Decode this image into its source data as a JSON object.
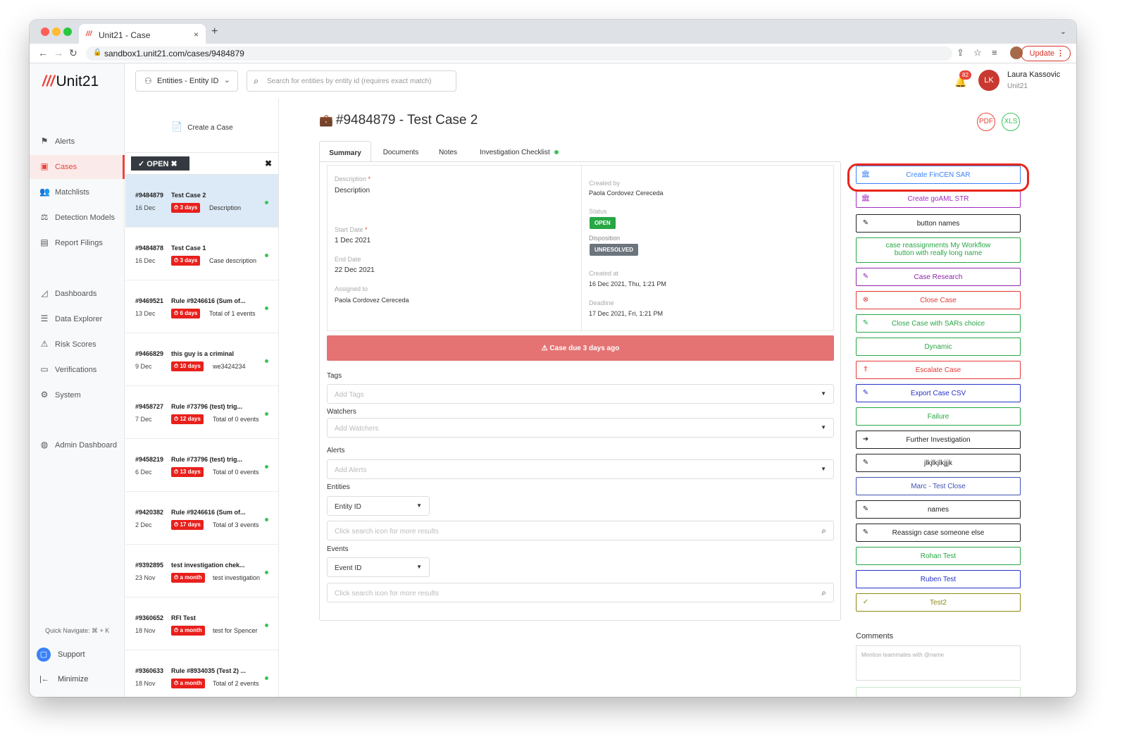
{
  "browser": {
    "tab_title": "Unit21 - Case",
    "tab_favicon": "///",
    "tab_close": "×",
    "new_tab": "+",
    "url": "sandbox1.unit21.com/cases/9484879",
    "update_label": "Update"
  },
  "sidebar": {
    "logo_slash": "///",
    "logo_text": "Unit21",
    "items": [
      {
        "label": "Alerts",
        "icon": "flag-icon",
        "glyph": "⚑"
      },
      {
        "label": "Cases",
        "icon": "briefcase-icon",
        "glyph": "▣"
      },
      {
        "label": "Matchlists",
        "icon": "people-icon",
        "glyph": "👥"
      },
      {
        "label": "Detection Models",
        "icon": "scale-icon",
        "glyph": "⚖"
      },
      {
        "label": "Report Filings",
        "icon": "filing-icon",
        "glyph": "▤"
      },
      {
        "label": "Dashboards",
        "icon": "chart-icon",
        "glyph": "◿"
      },
      {
        "label": "Data Explorer",
        "icon": "explorer-icon",
        "glyph": "☰"
      },
      {
        "label": "Risk Scores",
        "icon": "warning-icon",
        "glyph": "⚠"
      },
      {
        "label": "Verifications",
        "icon": "id-card-icon",
        "glyph": "▭"
      },
      {
        "label": "System",
        "icon": "gear-icon",
        "glyph": "⚙"
      },
      {
        "label": "Admin Dashboard",
        "icon": "globe-icon",
        "glyph": "◍"
      }
    ],
    "active": "Cases",
    "quick_navigate": "Quick Navigate: ⌘ + K",
    "support": "Support",
    "minimize": "Minimize"
  },
  "header": {
    "entity_selector": "Entities - Entity ID",
    "search_placeholder": "Search for entities by entity id (requires exact match)",
    "notification_count": "82",
    "user_initials": "LK",
    "user_name": "Laura Kassovic",
    "user_org": "Unit21"
  },
  "case_list": {
    "create_label": "Create a Case",
    "filter_chip": "OPEN",
    "cases": [
      {
        "id": "#9484879",
        "title": "Test Case 2",
        "date": "16 Dec",
        "age": "3 days",
        "desc": "Description",
        "selected": true
      },
      {
        "id": "#9484878",
        "title": "Test Case 1",
        "date": "16 Dec",
        "age": "3 days",
        "desc": "Case description"
      },
      {
        "id": "#9469521",
        "title": "Rule #9246616 (Sum of...",
        "date": "13 Dec",
        "age": "6 days",
        "desc": "Total of 1 events"
      },
      {
        "id": "#9466829",
        "title": "this guy is a criminal",
        "date": "9 Dec",
        "age": "10 days",
        "desc": "we3424234"
      },
      {
        "id": "#9458727",
        "title": "Rule #73796 (test) trig...",
        "date": "7 Dec",
        "age": "12 days",
        "desc": "Total of 0 events"
      },
      {
        "id": "#9458219",
        "title": "Rule #73796 (test) trig...",
        "date": "6 Dec",
        "age": "13 days",
        "desc": "Total of 0 events"
      },
      {
        "id": "#9420382",
        "title": "Rule #9246616 (Sum of...",
        "date": "2 Dec",
        "age": "17 days",
        "desc": "Total of 3 events"
      },
      {
        "id": "#9392895",
        "title": "test investigation chek...",
        "date": "23 Nov",
        "age": "a month",
        "desc": "test investigation"
      },
      {
        "id": "#9360652",
        "title": "RFI Test",
        "date": "18 Nov",
        "age": "a month",
        "desc": "test for Spencer"
      },
      {
        "id": "#9360633",
        "title": "Rule #8934035 (Test 2) ...",
        "date": "18 Nov",
        "age": "a month",
        "desc": "Total of 2 events"
      }
    ]
  },
  "case": {
    "title": "#9484879 - Test Case 2",
    "tabs": [
      "Summary",
      "Documents",
      "Notes",
      "Investigation Checklist"
    ],
    "active_tab": "Summary",
    "description_label": "Description",
    "description_value": "Description",
    "start_date_label": "Start Date",
    "start_date": "1 Dec 2021",
    "end_date_label": "End Date",
    "end_date": "22 Dec 2021",
    "assigned_label": "Assigned to",
    "assigned_to": "Paola Cordovez Cereceda",
    "created_by_label": "Created by",
    "created_by": "Paola Cordovez Cereceda",
    "status_label": "Status",
    "status": "OPEN",
    "disposition_label": "Disposition",
    "disposition": "UNRESOLVED",
    "created_at_label": "Created at",
    "created_at": "16 Dec 2021, Thu, 1:21 PM",
    "deadline_label": "Deadline",
    "deadline": "17 Dec 2021, Fri, 1:21 PM",
    "due_banner": "Case due 3 days ago",
    "tags_label": "Tags",
    "tags_placeholder": "Add Tags",
    "watchers_label": "Watchers",
    "watchers_placeholder": "Add Watchers",
    "alerts_label": "Alerts",
    "alerts_placeholder": "Add Alerts",
    "entities_label": "Entities",
    "entities_select": "Entity ID",
    "entities_search": "Click search icon for more results",
    "events_label": "Events",
    "events_select": "Event ID",
    "events_search": "Click search icon for more results"
  },
  "actions": [
    {
      "label": "Create FinCEN SAR",
      "color": "#3b82f6",
      "icon": "bank-icon",
      "glyph": "🏛"
    },
    {
      "label": "Create goAML STR",
      "color": "#a22bbf",
      "icon": "bank-icon",
      "glyph": "🏛"
    },
    {
      "label": "button names",
      "color": "#222222",
      "icon": "edit-icon",
      "glyph": "✎"
    },
    {
      "label": "case reassignments My Workflow button with really long name",
      "color": "#28a745",
      "icon": "",
      "glyph": ""
    },
    {
      "label": "Case Research",
      "color": "#8e24aa",
      "icon": "edit-icon",
      "glyph": "✎"
    },
    {
      "label": "Close Case",
      "color": "#e53935",
      "icon": "close-circle-icon",
      "glyph": "⊗"
    },
    {
      "label": "Close Case with SARs choice",
      "color": "#28a745",
      "icon": "edit-icon",
      "glyph": "✎"
    },
    {
      "label": "Dynamic",
      "color": "#28a745",
      "icon": "",
      "glyph": ""
    },
    {
      "label": "Escalate Case",
      "color": "#e53935",
      "icon": "escalate-icon",
      "glyph": "⇑"
    },
    {
      "label": "Export Case CSV",
      "color": "#2632c9",
      "icon": "edit-icon",
      "glyph": "✎"
    },
    {
      "label": "Failure",
      "color": "#28a745",
      "icon": "",
      "glyph": ""
    },
    {
      "label": "Further Investigation",
      "color": "#222222",
      "icon": "arrow-circle-icon",
      "glyph": "➜"
    },
    {
      "label": "jlkjlkjlkjjjk",
      "color": "#222222",
      "icon": "edit-icon",
      "glyph": "✎"
    },
    {
      "label": "Marc - Test Close",
      "color": "#3f51b5",
      "icon": "",
      "glyph": ""
    },
    {
      "label": "names",
      "color": "#222222",
      "icon": "edit-icon",
      "glyph": "✎"
    },
    {
      "label": "Reassign case someone else",
      "color": "#222222",
      "icon": "edit-icon",
      "glyph": "✎"
    },
    {
      "label": "Rohan Test",
      "color": "#28a745",
      "icon": "",
      "glyph": ""
    },
    {
      "label": "Ruben Test",
      "color": "#2632c9",
      "icon": "",
      "glyph": ""
    },
    {
      "label": "Test2",
      "color": "#8d8a12",
      "icon": "check-circle-icon",
      "glyph": "✓"
    }
  ],
  "comments": {
    "label": "Comments",
    "placeholder": "Mention teammates with @name"
  }
}
